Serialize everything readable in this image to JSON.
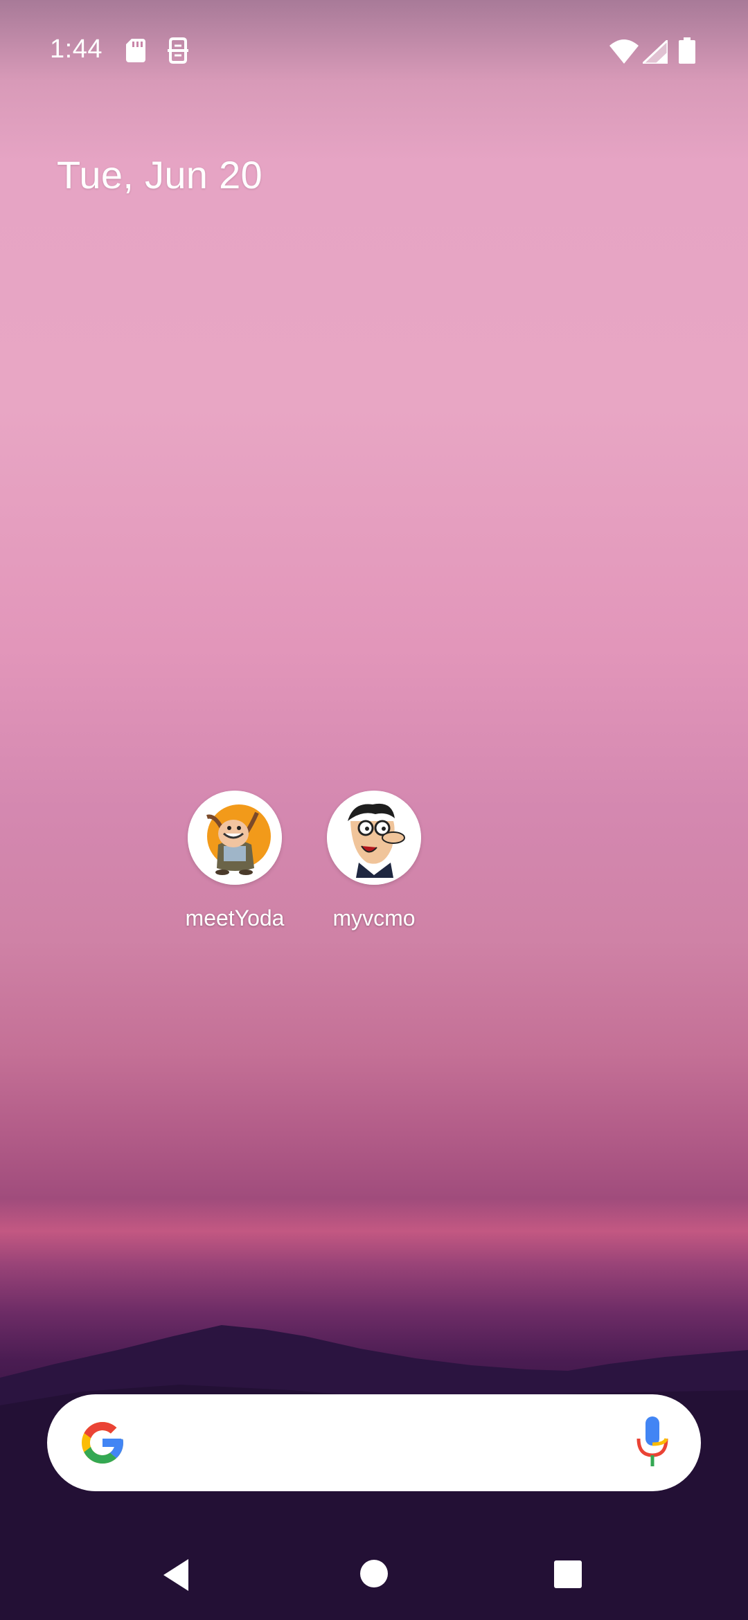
{
  "status_bar": {
    "time": "1:44",
    "left_icons": [
      "sd-card-icon",
      "privacy-cloud-icon"
    ],
    "right_icons": [
      "wifi-icon",
      "cell-signal-icon",
      "battery-icon"
    ]
  },
  "date_widget": {
    "text": "Tue, Jun 20"
  },
  "apps": [
    {
      "label": "meetYoda",
      "icon": "meetyoda-app-icon"
    },
    {
      "label": "myvcmo",
      "icon": "myvcmo-app-icon"
    }
  ],
  "search_bar": {
    "logo": "google-g-icon",
    "mic": "microphone-icon",
    "brand_colors": {
      "blue": "#4285F4",
      "red": "#EA4335",
      "yellow": "#FBBC05",
      "green": "#34A853"
    }
  },
  "nav_bar": {
    "buttons": [
      "back-button",
      "home-button",
      "recents-button"
    ]
  }
}
